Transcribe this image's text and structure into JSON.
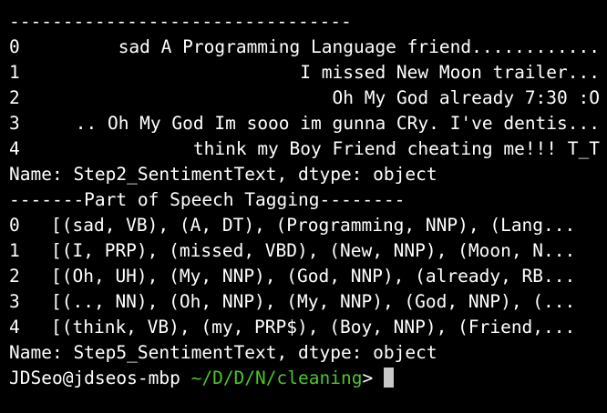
{
  "colors": {
    "background": "#000000",
    "text": "#ffffff",
    "path": "#4cc42a",
    "cursor": "#c8c8c8"
  },
  "top_separator": "--------------------------------",
  "step2": {
    "rows": [
      {
        "index": "0",
        "text": "sad A Programming Language friend............"
      },
      {
        "index": "1",
        "text": "I missed New Moon trailer..."
      },
      {
        "index": "2",
        "text": "Oh My God already 7:30 :O"
      },
      {
        "index": "3",
        "text": ".. Oh My God Im sooo im gunna CRy. I've dentis..."
      },
      {
        "index": "4",
        "text": "think my Boy Friend cheating me!!! T_T"
      }
    ],
    "footer": "Name: Step2_SentimentText, dtype: object"
  },
  "pos_header": "-------Part of Speech Tagging--------",
  "step5": {
    "rows": [
      {
        "index": "0",
        "text": "[(sad, VB), (A, DT), (Programming, NNP), (Lang..."
      },
      {
        "index": "1",
        "text": "[(I, PRP), (missed, VBD), (New, NNP), (Moon, N..."
      },
      {
        "index": "2",
        "text": "[(Oh, UH), (My, NNP), (God, NNP), (already, RB..."
      },
      {
        "index": "3",
        "text": "[(.., NN), (Oh, NNP), (My, NNP), (God, NNP), (..."
      },
      {
        "index": "4",
        "text": "[(think, VB), (my, PRP$), (Boy, NNP), (Friend,..."
      }
    ],
    "footer": "Name: Step5_SentimentText, dtype: object"
  },
  "prompt": {
    "user_host": "JDSeo@jdseos-mbp",
    "path": "~/D/D/N/cleaning",
    "symbol": ">"
  }
}
